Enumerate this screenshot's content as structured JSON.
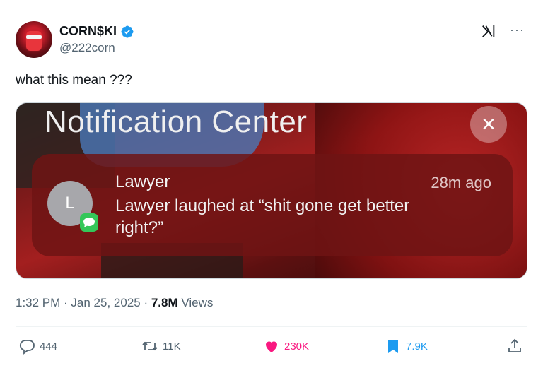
{
  "author": {
    "display_name": "CORN$KI",
    "handle": "@222corn",
    "verified": true,
    "verified_color": "#1d9bf0"
  },
  "header_icons": [
    "grok-icon",
    "more-icon"
  ],
  "tweet": {
    "text": "what this mean ???"
  },
  "media": {
    "notification_center_title": "Notification Center",
    "close_symbol": "×",
    "notification": {
      "avatar_letter": "L",
      "sender": "Lawyer",
      "time": "28m ago",
      "body": "Lawyer laughed at “shit gone get better right?”",
      "app_icon": "messages-icon"
    }
  },
  "meta": {
    "time": "1:32 PM",
    "separator": " · ",
    "date": "Jan 25, 2025",
    "views_count": "7.8M",
    "views_label": " Views"
  },
  "actions": {
    "replies": "444",
    "reposts": "11K",
    "likes": "230K",
    "bookmarks": "7.9K"
  },
  "colors": {
    "like_active": "#f91880",
    "bookmark_active": "#1d9bf0",
    "secondary_text": "#536471"
  }
}
